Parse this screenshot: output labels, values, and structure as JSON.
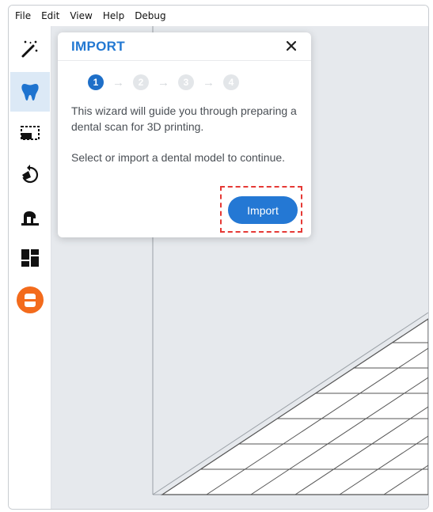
{
  "menu": {
    "items": [
      "File",
      "Edit",
      "View",
      "Help",
      "Debug"
    ]
  },
  "toolbar": {
    "tools": [
      {
        "name": "magic-wand-icon",
        "active": false
      },
      {
        "name": "tooth-icon",
        "active": true
      },
      {
        "name": "crop-icon",
        "active": false
      },
      {
        "name": "rotate-icon",
        "active": false
      },
      {
        "name": "base-icon",
        "active": false
      },
      {
        "name": "layout-icon",
        "active": false
      },
      {
        "name": "export-icon",
        "active": false
      }
    ],
    "accent": "#2278d2",
    "export_color": "#f36b1c"
  },
  "dialog": {
    "title": "IMPORT",
    "close_symbol": "✕",
    "steps": [
      "1",
      "2",
      "3",
      "4"
    ],
    "current_step": 1,
    "arrow_symbol": "→",
    "description_1": "This wizard will guide you through preparing a dental scan for 3D printing.",
    "description_2": "Select or import a dental model to continue.",
    "import_label": "Import",
    "button_color": "#2478d4"
  }
}
